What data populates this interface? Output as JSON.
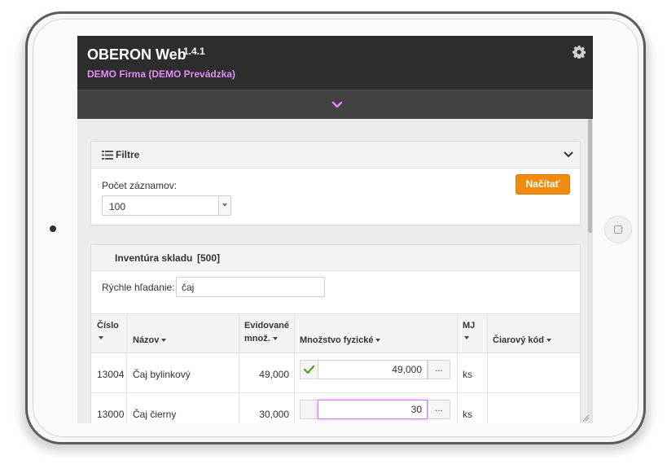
{
  "app": {
    "title": "OBERON Web",
    "version": "1.4.1",
    "company": "DEMO Firma (DEMO Prevádzka)",
    "accent_color": "#e38cf7"
  },
  "icons": {
    "settings": "gear-icon",
    "nav_toggle": "chevron-down-icon",
    "filter": "filter-list-icon",
    "collapse": "chevron-down-icon",
    "valid": "check-icon"
  },
  "filter_panel": {
    "title": "Filtre",
    "record_count_label": "Počet záznamov:",
    "record_count_value": "100",
    "load_button": "Načítať"
  },
  "inventory": {
    "title": "Inventúra skladu",
    "count": "[500]",
    "quick_search_label": "Rýchle hľadanie:",
    "quick_search_value": "čaj",
    "columns": {
      "cislo": "Číslo",
      "nazov": "Názov",
      "evid_line1": "Evidované",
      "evid_line2": "množ.",
      "mnozstvo": "Množstvo fyzické",
      "mj": "MJ",
      "kod": "Čiarový kód"
    },
    "rows": [
      {
        "cislo": "13004",
        "nazov": "Čaj bylinkový",
        "evidovane": "49,000",
        "fyzicke": "49,000",
        "mj": "ks",
        "kod": "",
        "dots": "...",
        "confirmed": true
      },
      {
        "cislo": "13000",
        "nazov": "Čaj čierny",
        "evidovane": "30,000",
        "fyzicke": "30",
        "mj": "ks",
        "kod": "",
        "dots": "...",
        "confirmed": false
      }
    ]
  }
}
